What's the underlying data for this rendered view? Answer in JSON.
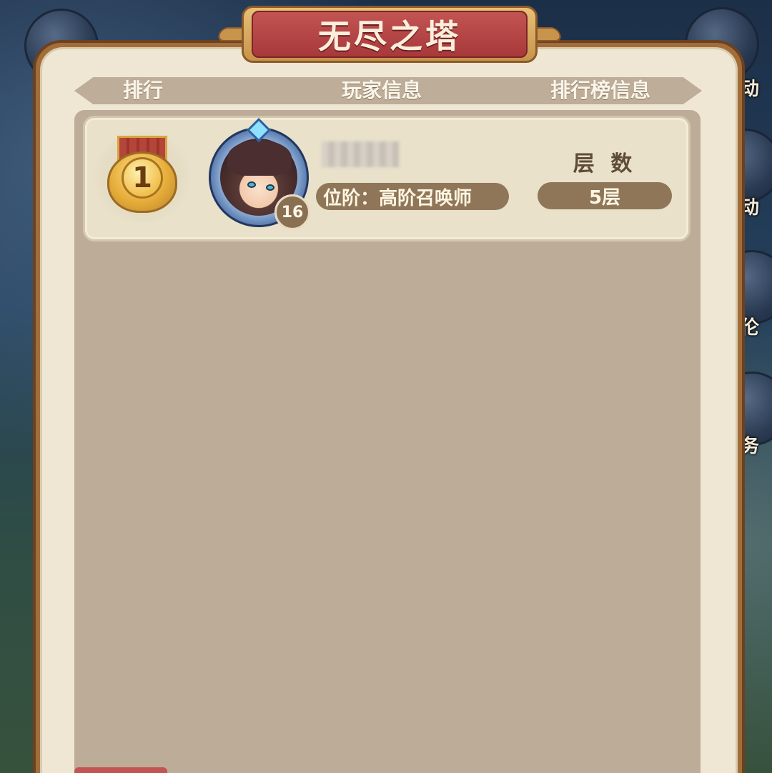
{
  "panel": {
    "title": "无尽之塔",
    "header": {
      "rank": "排行",
      "player_info": "玩家信息",
      "leaderboard_info": "排行榜信息"
    },
    "entries": [
      {
        "rank": "1",
        "player_name": "",
        "level": "16",
        "rank_title": "位阶：高阶召唤师",
        "floors_label": "层 数",
        "floors_value": "5层"
      }
    ]
  },
  "background": {
    "side_labels": [
      "动",
      "动",
      "伦",
      "务"
    ]
  },
  "icons": {
    "rank_medal": "gold-medal-icon",
    "avatar": "player-avatar",
    "level": "level-badge"
  },
  "colors": {
    "title_red": "#a8393b",
    "frame_brown": "#a36d3a",
    "pill_brown": "#8f7659",
    "panel_beige": "#efe7d4"
  }
}
